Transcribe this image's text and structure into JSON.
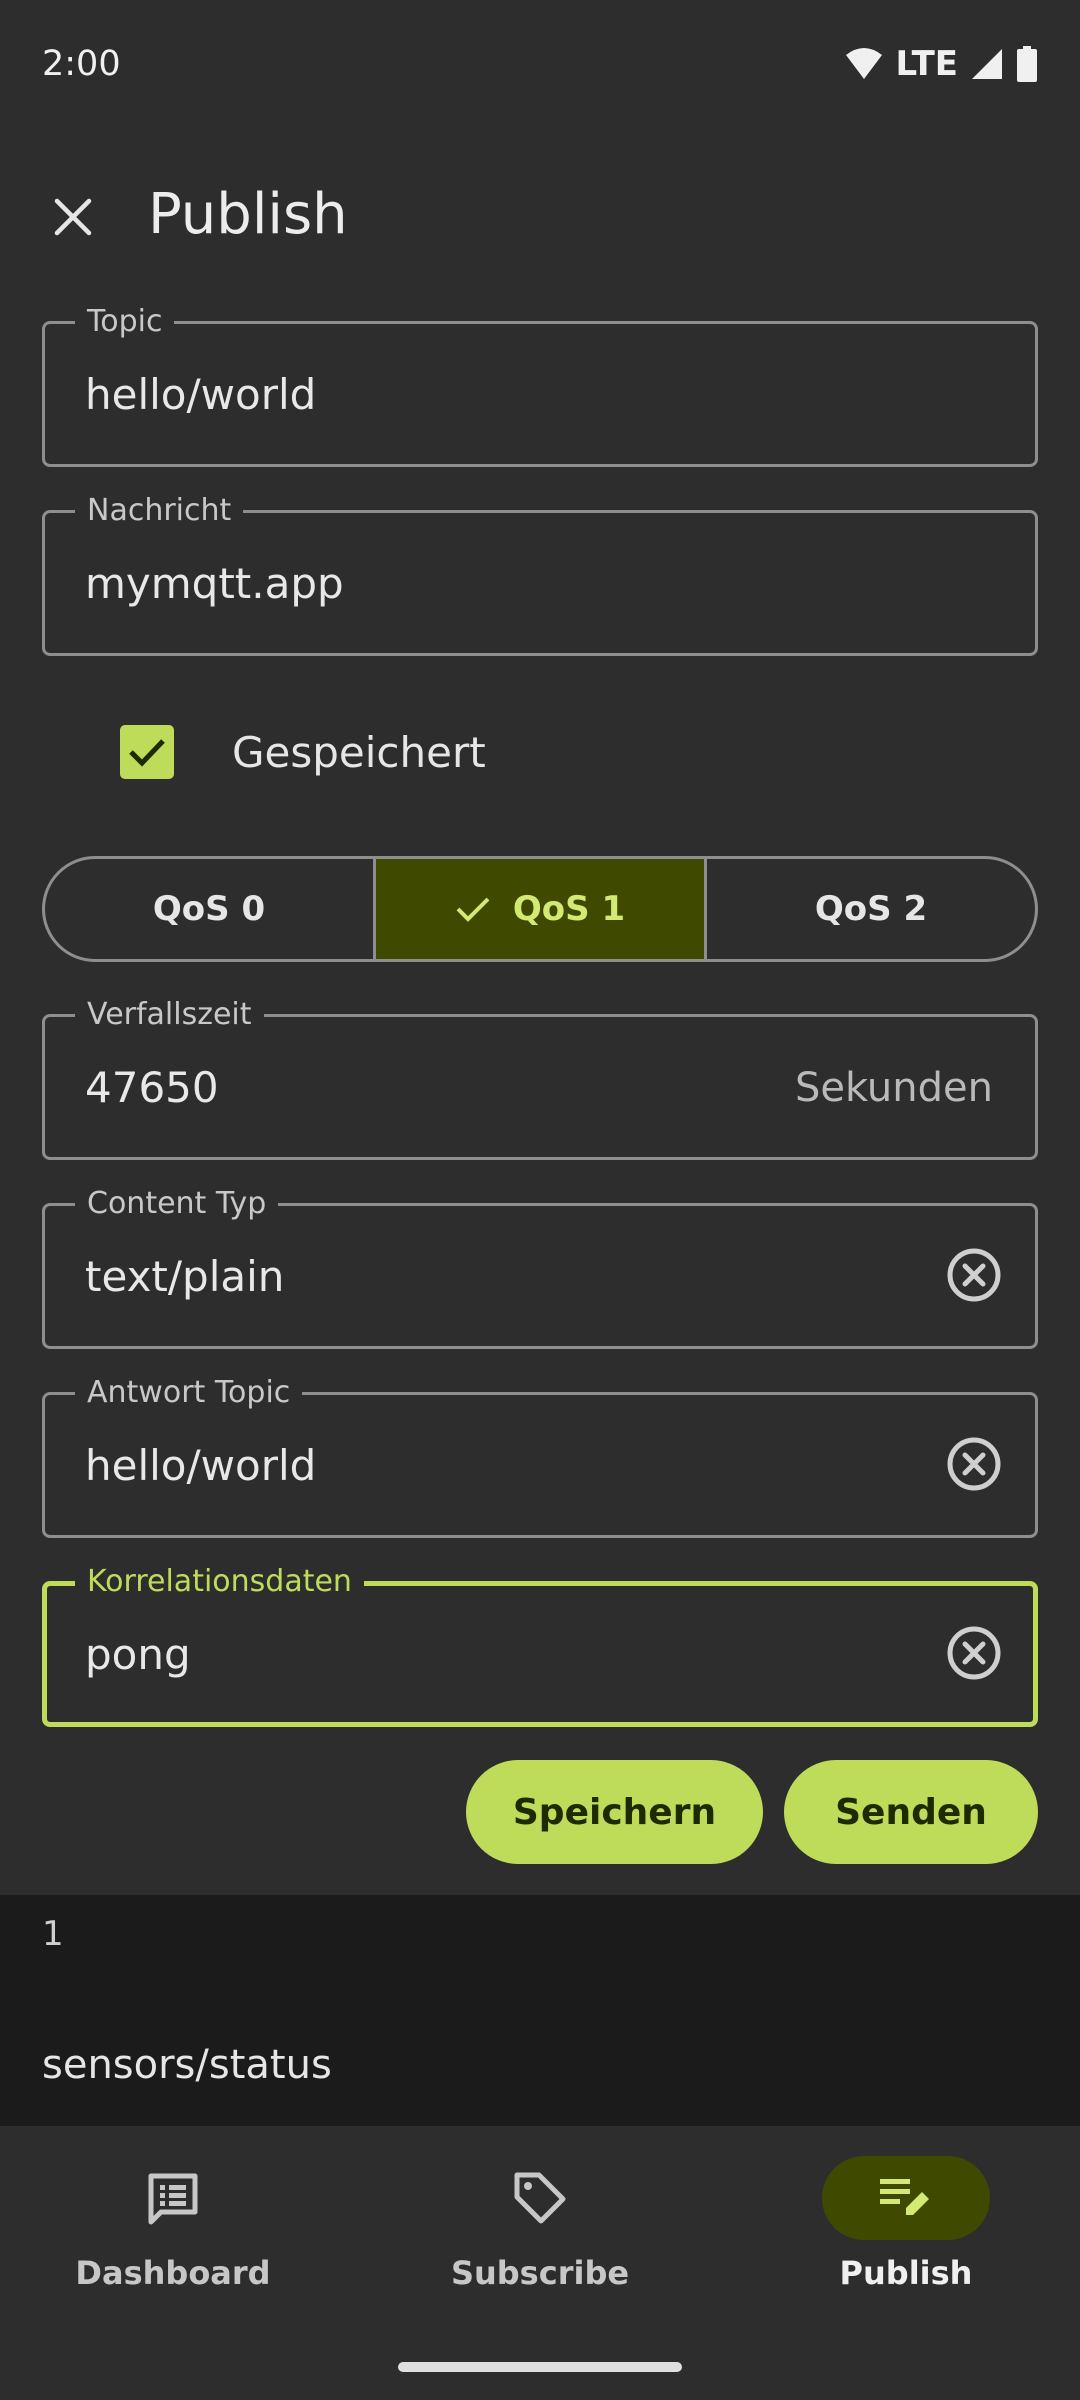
{
  "status_bar": {
    "time": "2:00",
    "network": "LTE"
  },
  "header": {
    "title": "Publish"
  },
  "form": {
    "topic": {
      "label": "Topic",
      "value": "hello/world"
    },
    "message": {
      "label": "Nachricht",
      "value": "mymqtt.app"
    },
    "retained": {
      "label": "Gespeichert",
      "checked": true
    },
    "qos": {
      "options": [
        "QoS 0",
        "QoS 1",
        "QoS 2"
      ],
      "selected": "QoS 1"
    },
    "expiry": {
      "label": "Verfallszeit",
      "value": "47650",
      "suffix": "Sekunden"
    },
    "content_type": {
      "label": "Content Typ",
      "value": "text/plain"
    },
    "response_topic": {
      "label": "Antwort Topic",
      "value": "hello/world"
    },
    "correlation_data": {
      "label": "Korrelationsdaten",
      "value": "pong"
    }
  },
  "actions": {
    "save": "Speichern",
    "send": "Senden"
  },
  "background_list": [
    {
      "value": "1"
    },
    {
      "topic": "sensors/status"
    }
  ],
  "bottom_nav": {
    "items": [
      {
        "label": "Dashboard",
        "icon": "dashboard-icon"
      },
      {
        "label": "Subscribe",
        "icon": "tag-icon"
      },
      {
        "label": "Publish",
        "icon": "publish-icon"
      }
    ],
    "active": "Publish"
  },
  "colors": {
    "accent": "#bedc5a",
    "accent_container": "#3f4a00",
    "surface": "#2d2d2d",
    "background": "#1c1c1c"
  }
}
